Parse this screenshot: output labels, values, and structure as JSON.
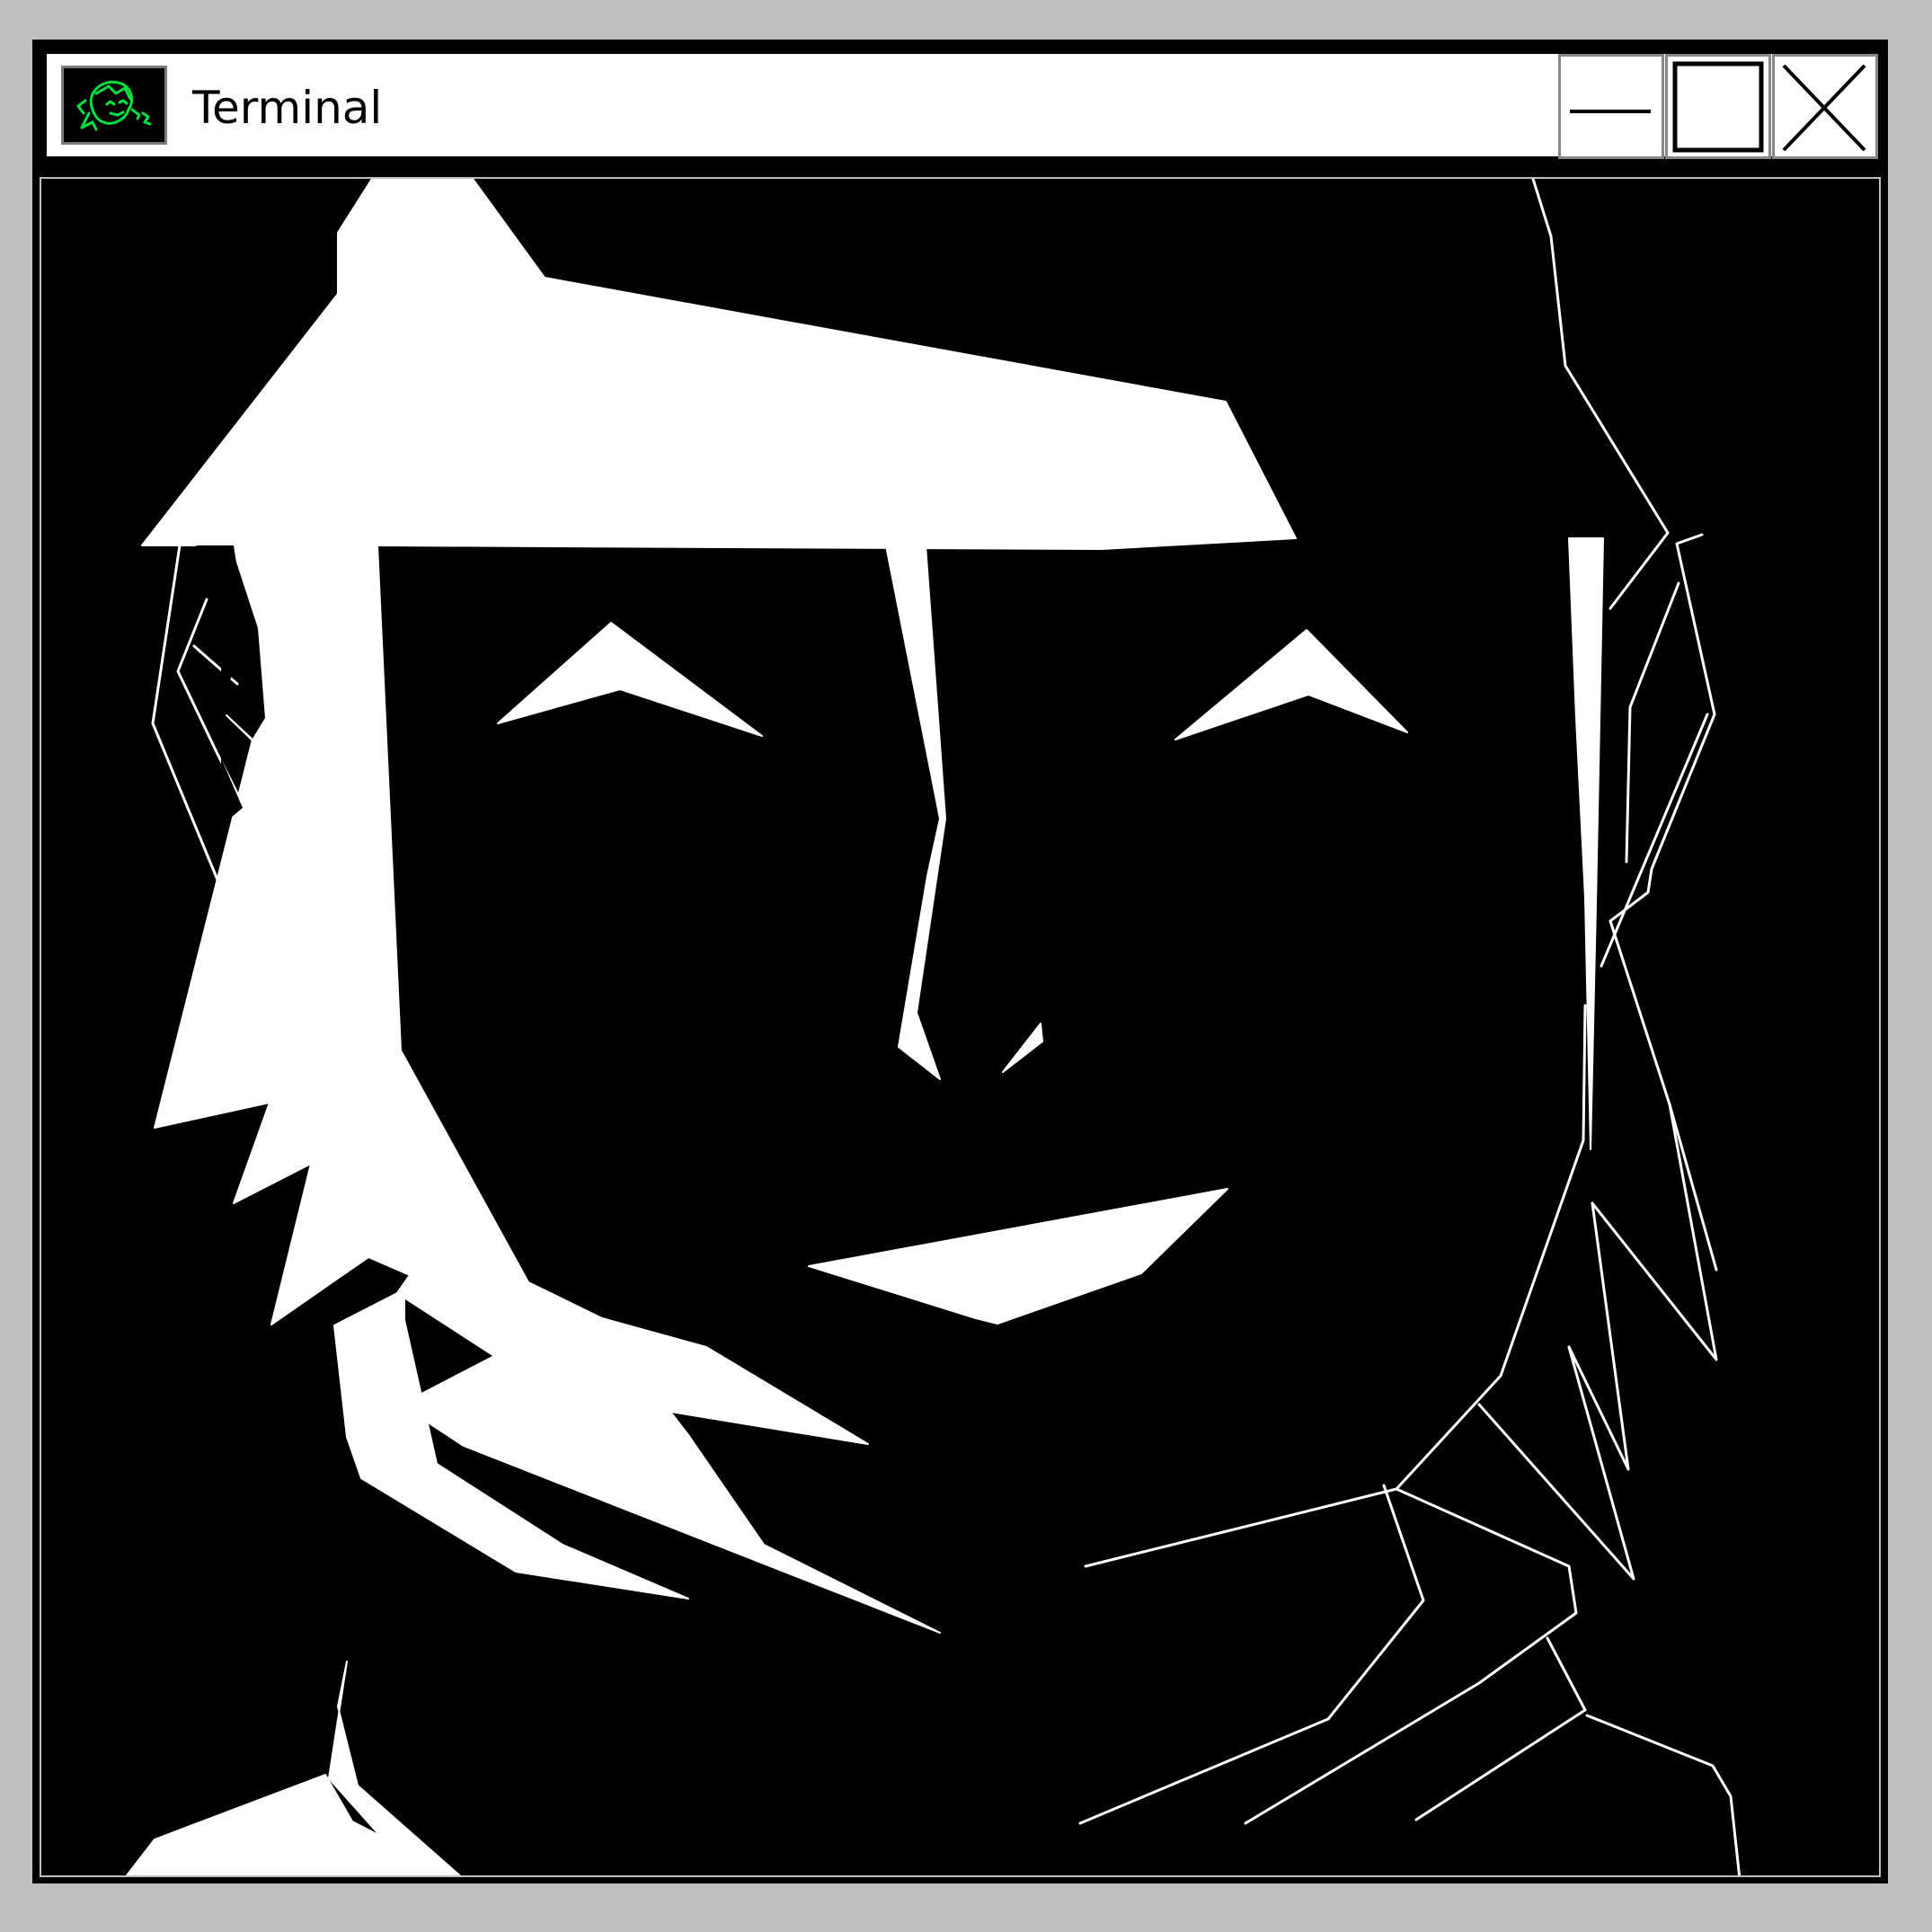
{
  "window": {
    "title": "Terminal",
    "icon": "smiling-face-icon",
    "buttons": {
      "minimize": "minimize-icon",
      "maximize": "maximize-icon",
      "close": "close-icon"
    },
    "colors": {
      "desktop": "#c0c0c0",
      "frame": "#000000",
      "titlebar": "#ffffff",
      "icon_glyph": "#00e040",
      "terminal_background": "#000000",
      "art_foreground": "#ffffff"
    }
  }
}
